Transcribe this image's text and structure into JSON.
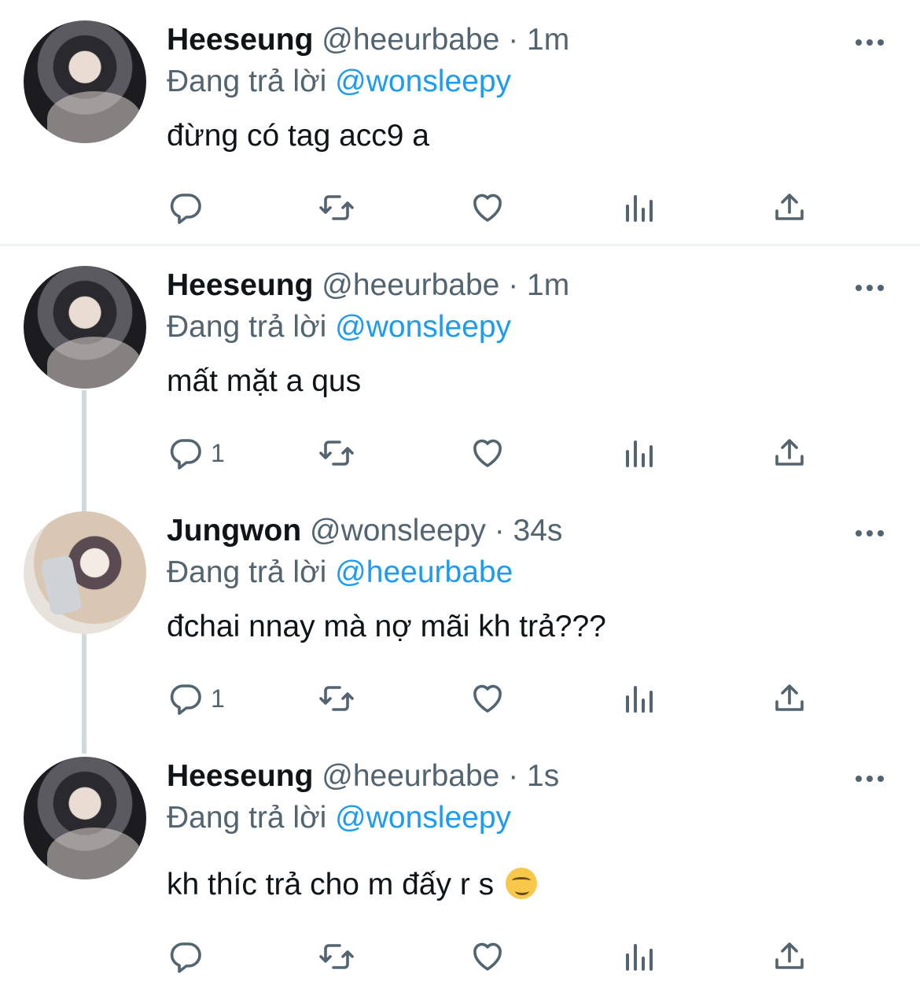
{
  "reply_prefix": "Đang trả lời",
  "tweets": [
    {
      "name": "Heeseung",
      "handle": "@heeurbabe",
      "separator": "·",
      "time": "1m",
      "reply_to": "@wonsleepy",
      "text": "đừng có tag acc9 a",
      "reply_count": ""
    },
    {
      "name": "Heeseung",
      "handle": "@heeurbabe",
      "separator": "·",
      "time": "1m",
      "reply_to": "@wonsleepy",
      "text": "mất mặt a qus",
      "reply_count": "1"
    },
    {
      "name": "Jungwon",
      "handle": "@wonsleepy",
      "separator": "·",
      "time": "34s",
      "reply_to": "@heeurbabe",
      "text": "đchai nnay mà nợ mãi kh trả???",
      "reply_count": "1"
    },
    {
      "name": "Heeseung",
      "handle": "@heeurbabe",
      "separator": "·",
      "time": "1s",
      "reply_to": "@wonsleepy",
      "text": "kh thíc trả cho m đấy r s",
      "emoji": "smirk-emoji",
      "reply_count": ""
    }
  ],
  "icons": {
    "reply": "comment-icon",
    "retweet": "retweet-icon",
    "like": "heart-icon",
    "views": "views-icon",
    "share": "share-icon",
    "more": "more-icon"
  },
  "colors": {
    "accent": "#1d9bf0",
    "secondary_text": "#536471",
    "primary_text": "#0f1419",
    "thread_line": "#cfd9de"
  }
}
